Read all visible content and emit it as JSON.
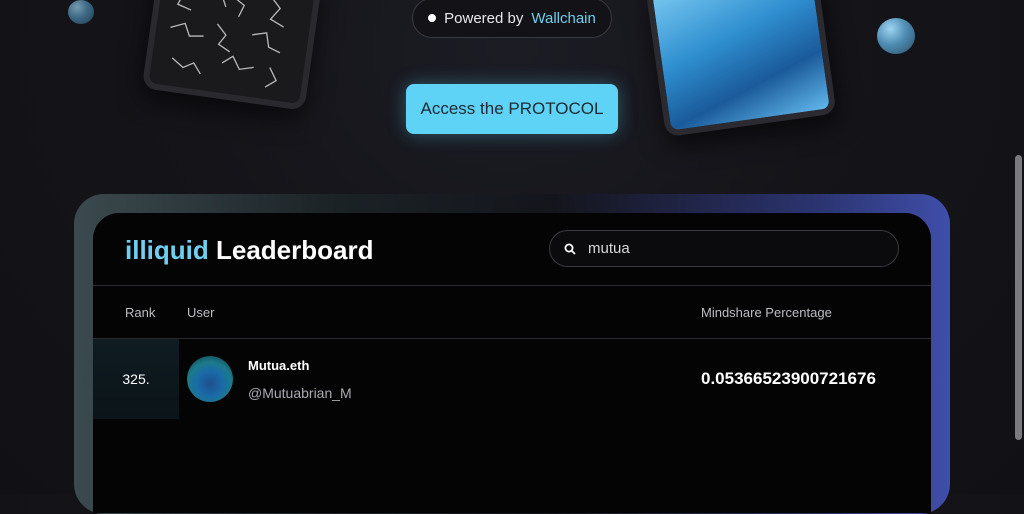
{
  "hero": {
    "powered_prefix": "Powered by",
    "powered_brand": "Wallchain",
    "cta_label": "Access the PROTOCOL"
  },
  "leaderboard": {
    "title_accent": "illiquid",
    "title_rest": "Leaderboard",
    "search": {
      "value": "mutua",
      "icon": "search-icon"
    },
    "columns": {
      "rank": "Rank",
      "user": "User",
      "mindshare": "Mindshare Percentage"
    },
    "rows": [
      {
        "rank": "325.",
        "name": "Mutua.eth",
        "handle": "@Mutuabrian_M",
        "mindshare": "0.05366523900721676"
      }
    ]
  },
  "colors": {
    "accent": "#6ecff0",
    "button": "#5fd3f5",
    "background": "#141419"
  }
}
